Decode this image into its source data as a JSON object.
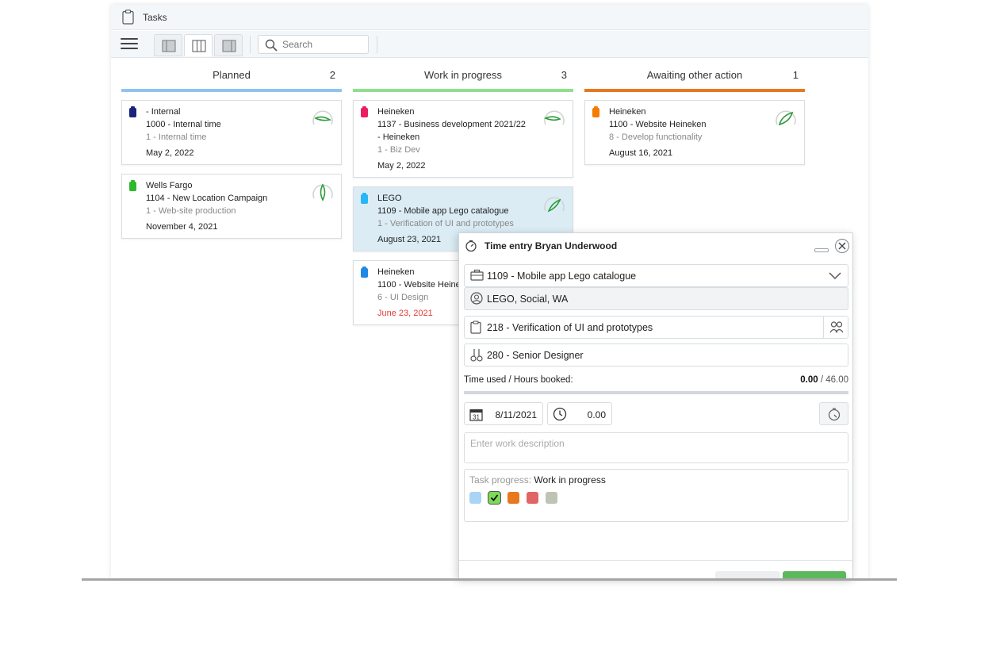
{
  "window": {
    "title": "Tasks"
  },
  "toolbar": {
    "search_placeholder": "Search",
    "views": [
      "list-view",
      "board-view",
      "detail-view"
    ],
    "active_view": "board-view"
  },
  "board": {
    "columns": [
      {
        "name": "Planned",
        "count": "2",
        "color": "#8fc3f2",
        "cards": [
          {
            "customer": "- Internal",
            "project": "1000 - Internal time",
            "project2": "",
            "task": "1 - Internal time",
            "date": "May 2, 2022",
            "tag_color": "#1a237e",
            "overdue": false
          },
          {
            "customer": "Wells Fargo",
            "project": "1104 - New Location Campaign",
            "project2": "",
            "task": "1 - Web-site production",
            "date": "November 4, 2021",
            "tag_color": "#2eb82e",
            "overdue": false
          }
        ]
      },
      {
        "name": "Work in progress",
        "count": "3",
        "color": "#8ee08e",
        "cards": [
          {
            "customer": "Heineken",
            "project": "1137 - Business development 2021/22",
            "project2": "- Heineken",
            "task": "1 - Biz Dev",
            "date": "May 2, 2022",
            "tag_color": "#e91e63",
            "overdue": false
          },
          {
            "customer": "LEGO",
            "project": "1109 - Mobile app Lego catalogue",
            "project2": "",
            "task": "1 - Verification of UI and prototypes",
            "date": "August 23, 2021",
            "tag_color": "#29b6f6",
            "overdue": false
          },
          {
            "customer": "Heineken",
            "project": "1100 - Website Heineken",
            "project2": "",
            "task": "6 - UI Design",
            "date": "June 23, 2021",
            "tag_color": "#1e88e5",
            "overdue": true
          }
        ]
      },
      {
        "name": "Awaiting other action",
        "count": "1",
        "color": "#e8781e",
        "cards": [
          {
            "customer": "Heineken",
            "project": "1100 - Website Heineken",
            "project2": "",
            "task": "8 - Develop functionality",
            "date": "August 16, 2021",
            "tag_color": "#f57c00",
            "overdue": false
          }
        ]
      }
    ]
  },
  "dialog": {
    "title": "Time entry Bryan Underwood",
    "project": "1109 - Mobile app Lego catalogue",
    "customer": "LEGO, Social, WA",
    "task": "218 - Verification of UI and prototypes",
    "role": "280 - Senior Designer",
    "hours_label": "Time used / Hours booked:",
    "hours_used": "0.00",
    "hours_booked": " / 46.00",
    "date": "8/11/2021",
    "time": "0.00",
    "description_placeholder": "Enter work description",
    "progress_label": "Task progress: ",
    "progress_value": "Work in progress",
    "progress_swatches": [
      "#a9d4f5",
      "#7ed957",
      "#e8781e",
      "#e06666",
      "#bfc3b4"
    ],
    "progress_checked_index": 1
  }
}
